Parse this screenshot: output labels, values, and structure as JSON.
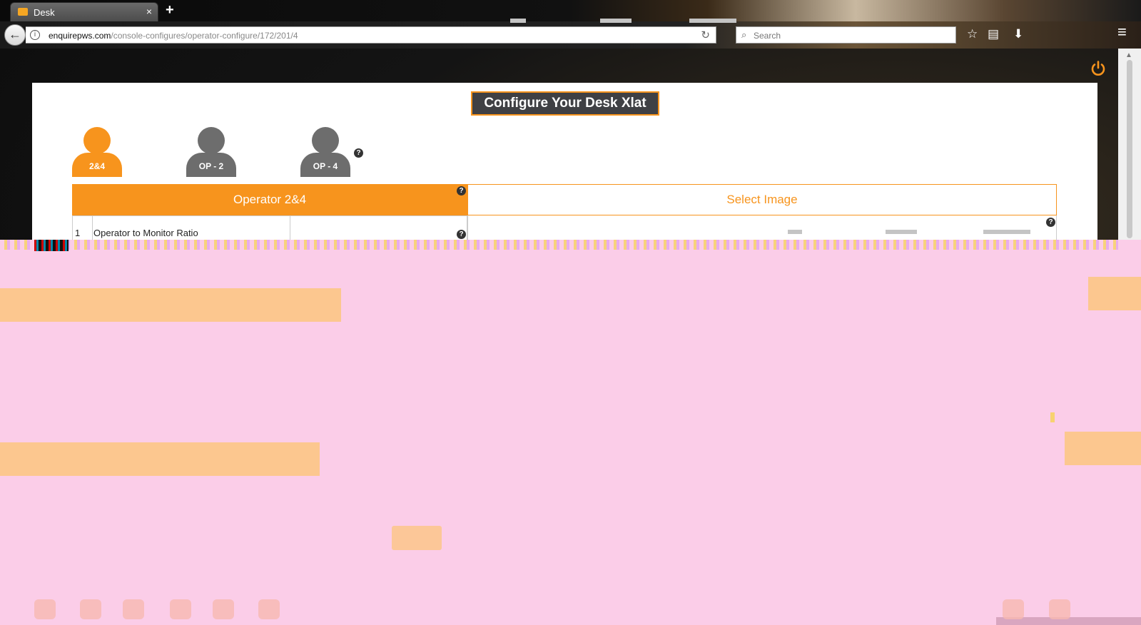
{
  "browser": {
    "tab_title": "Desk",
    "tab_close": "×",
    "new_tab": "+",
    "back": "←",
    "info": "i",
    "url_host": "enquirepws.com",
    "url_path": "/console-configures/operator-configure/172/201/4",
    "reload": "↻",
    "search_icon": "⌕",
    "search_placeholder": "Search",
    "bookmark": "☆",
    "library": "▤",
    "download": "⬇",
    "menu": "≡"
  },
  "page": {
    "title": "Configure Your Desk Xlat",
    "operators": [
      {
        "label": "2&4",
        "active": true
      },
      {
        "label": "OP - 2",
        "active": false
      },
      {
        "label": "OP - 4",
        "active": false
      }
    ],
    "help_glyph": "?",
    "tabs": {
      "operator": "Operator 2&4",
      "image": "Select Image"
    },
    "table": {
      "rows": [
        {
          "num": "1",
          "label": "Operator to Monitor Ratio"
        }
      ]
    }
  },
  "colors": {
    "accent": "#f7941d",
    "title_bg": "#3f4044",
    "inactive_operator": "#6d6d6d"
  }
}
